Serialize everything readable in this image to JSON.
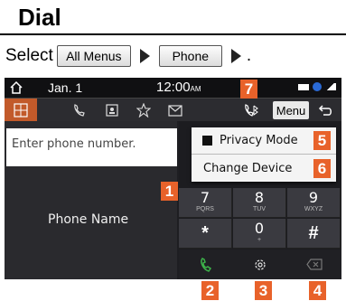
{
  "header": {
    "title": "Dial"
  },
  "instruction": {
    "prefix": "Select",
    "menu_chip": "All Menus",
    "phone_chip": "Phone",
    "suffix": "."
  },
  "status": {
    "date": "Jan.  1",
    "time": "12:00",
    "ampm": "AM"
  },
  "tabs": [
    "keypad-tab",
    "recent-calls-tab",
    "contacts-tab",
    "favorites-tab",
    "messages-tab"
  ],
  "toolbar": {
    "menu_label": "Menu"
  },
  "input": {
    "placeholder": "Enter phone number."
  },
  "left": {
    "phone_name": "Phone Name"
  },
  "dropdown": {
    "privacy_mode": "Privacy Mode",
    "change_device": "Change Device"
  },
  "keys": [
    {
      "digit": "7",
      "sub": "PQRS"
    },
    {
      "digit": "8",
      "sub": "TUV"
    },
    {
      "digit": "9",
      "sub": "WXYZ"
    },
    {
      "digit": "*",
      "sub": ""
    },
    {
      "digit": "0",
      "sub": "+"
    },
    {
      "digit": "#",
      "sub": ""
    }
  ],
  "callouts": [
    "1",
    "2",
    "3",
    "4",
    "5",
    "6",
    "7"
  ],
  "colors": {
    "accent": "#e8622a",
    "call_green": "#3db24a",
    "tab_active": "#c25a2a"
  }
}
